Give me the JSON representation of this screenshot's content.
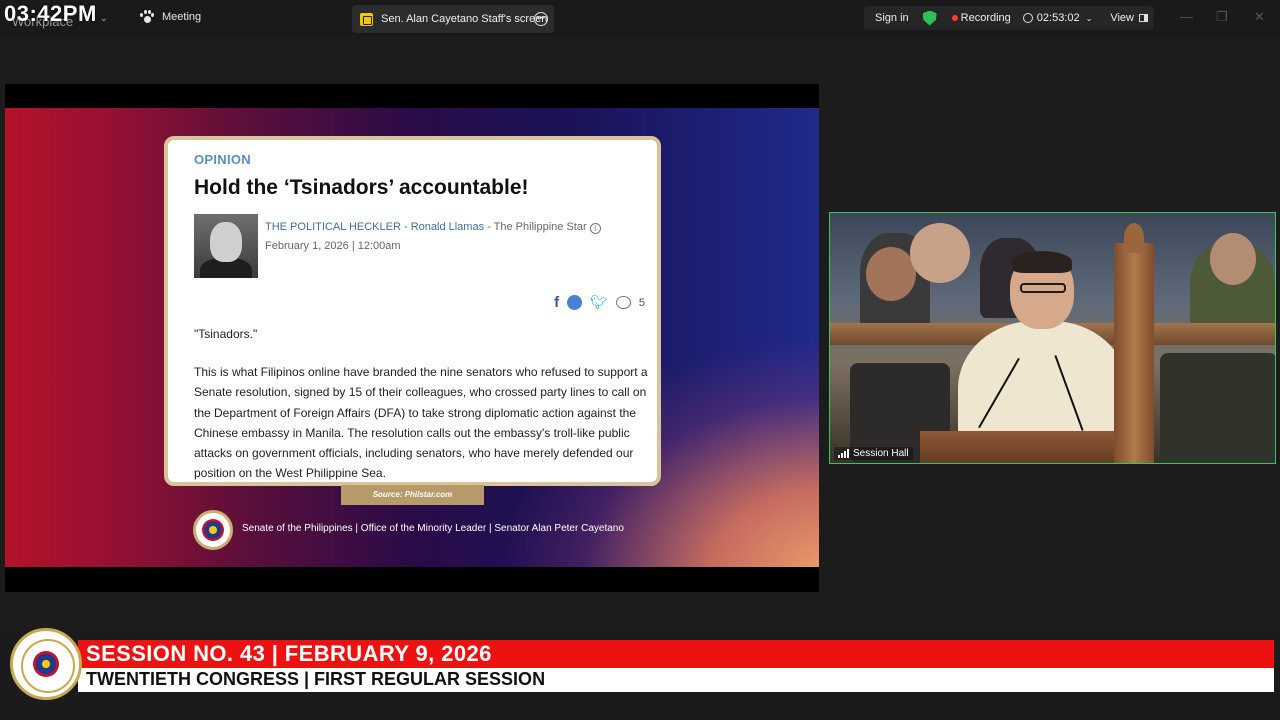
{
  "overlay": {
    "clock": "03:42PM"
  },
  "topbar": {
    "workplace": "Workplace",
    "meeting_label": "Meeting",
    "share_tab": "Sen. Alan Cayetano Staff's screen",
    "sign_in": "Sign in",
    "recording_label": "Recording",
    "recording_time": "02:53:02",
    "view_label": "View"
  },
  "slide": {
    "article": {
      "section": "OPINION",
      "headline": "Hold the ‘Tsinadors’ accountable!",
      "column": "THE POLITICAL HECKLER",
      "author": "Ronald Llamas",
      "publication": "The Philippine Star",
      "date": "February 1, 2026 | 12:00am",
      "comment_count": "5",
      "quote": "\"Tsinadors.\"",
      "body": "This is what Filipinos online have branded the nine senators who refused to support a Senate resolution, signed by 15 of their colleagues, who crossed party lines to call on the Department of Foreign Affairs (DFA) to take strong diplomatic action against the Chinese embassy in Manila. The resolution calls out the embassy's troll-like public attacks on government officials, including senators, who have merely defended our position on the West Philippine Sea."
    },
    "source": "Source: Philstar.com",
    "footer": "Senate of the Philippines | Office of the Minority Leader | Senator Alan Peter Cayetano"
  },
  "video": {
    "label": "Session Hall"
  },
  "lower_third": {
    "title": "SESSION NO. 43 | FEBRUARY 9, 2026",
    "subtitle": "TWENTIETH CONGRESS | FIRST REGULAR SESSION"
  },
  "colors": {
    "accent_red": "#ed1111",
    "active_speaker": "#36c957",
    "recording_dot": "#ff3b30"
  }
}
